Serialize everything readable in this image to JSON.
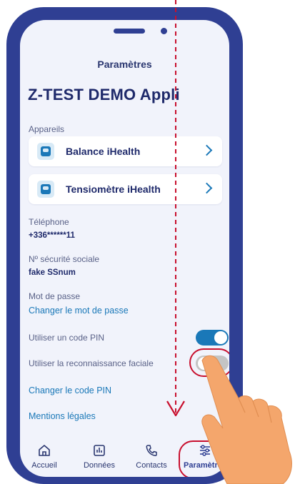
{
  "header": {
    "title": "Paramètres"
  },
  "app": {
    "title": "Z-TEST DEMO Appli"
  },
  "devices": {
    "label": "Appareils",
    "items": [
      {
        "label": "Balance iHealth",
        "icon": "scale-icon"
      },
      {
        "label": "Tensiomètre iHealth",
        "icon": "blood-pressure-icon"
      }
    ]
  },
  "phone": {
    "label": "Téléphone",
    "value": "+336******11"
  },
  "ssn": {
    "label": "Nº sécurité sociale",
    "value": "fake SSnum"
  },
  "password": {
    "label": "Mot de passe",
    "link": "Changer le mot de passe"
  },
  "pin": {
    "label": "Utiliser un code PIN",
    "enabled": true
  },
  "face": {
    "label": "Utiliser la reconnaissance faciale",
    "enabled": false
  },
  "change_pin": {
    "link": "Changer le code PIN"
  },
  "legal": {
    "link": "Mentions légales"
  },
  "nav": {
    "items": [
      {
        "label": "Accueil",
        "icon": "home-icon",
        "active": false
      },
      {
        "label": "Données",
        "icon": "chart-icon",
        "active": false
      },
      {
        "label": "Contacts",
        "icon": "phone-icon",
        "active": false
      },
      {
        "label": "Paramètres",
        "icon": "sliders-icon",
        "active": true
      }
    ]
  },
  "colors": {
    "frame": "#2f3f93",
    "screen_bg": "#f1f3fb",
    "accent": "#1a78b8",
    "title": "#1f2a6b",
    "highlight": "#c8102e",
    "toggle_off": "#c4c4c4",
    "hand": "#f4a66c"
  }
}
